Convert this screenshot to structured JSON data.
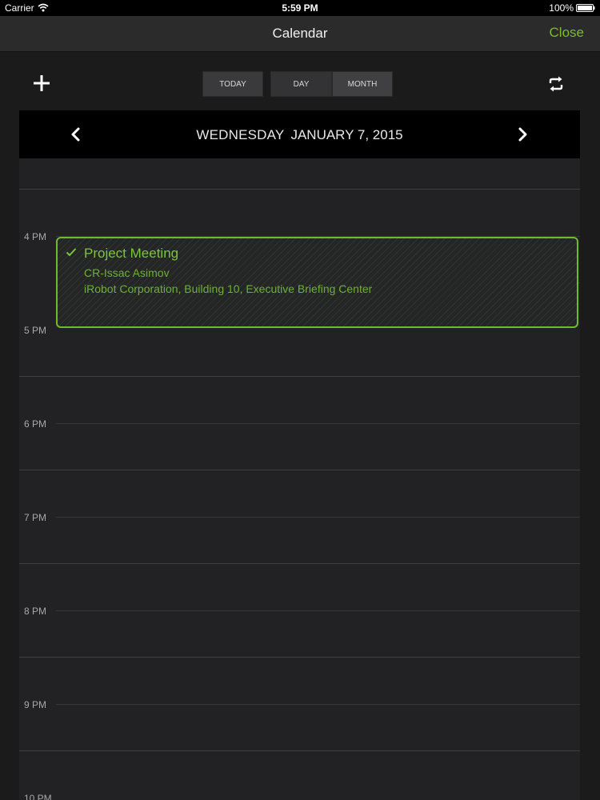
{
  "status_bar": {
    "carrier": "Carrier",
    "time": "5:59 PM",
    "battery": "100%"
  },
  "nav": {
    "title": "Calendar",
    "close_label": "Close"
  },
  "toolbar": {
    "add_icon": "plus-icon",
    "today_label": "TODAY",
    "day_label": "DAY",
    "month_label": "MONTH",
    "sync_icon": "sync-icon"
  },
  "date_header": {
    "weekday": "WEDNESDAY",
    "date": "JANUARY 7, 2015"
  },
  "hours": [
    "4 PM",
    "5 PM",
    "6 PM",
    "7 PM",
    "8 PM",
    "9 PM",
    "10 PM"
  ],
  "event": {
    "title": "Project Meeting",
    "organizer": "CR-Issac Asimov",
    "location": "iRobot Corporation, Building 10, Executive Briefing Center",
    "status_icon": "check-icon"
  },
  "colors": {
    "accent": "#7dbb2f",
    "background": "#1b1b1c",
    "header_bg": "#000000"
  }
}
